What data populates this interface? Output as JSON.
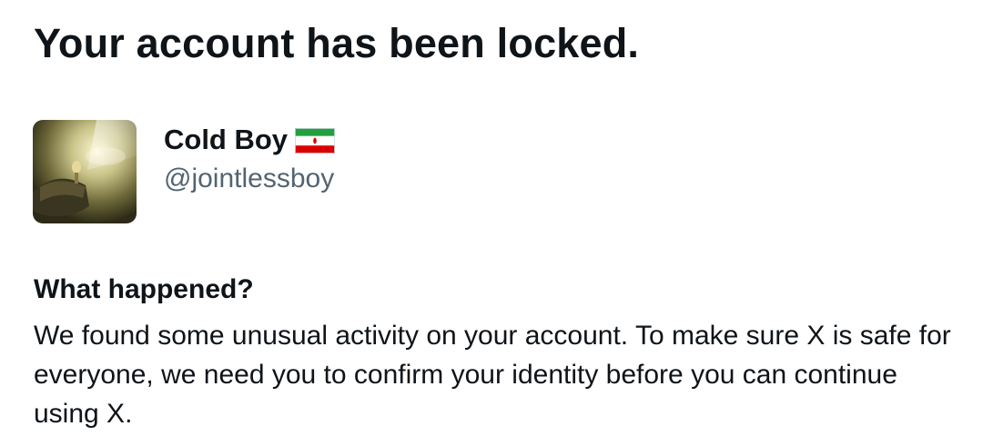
{
  "header": {
    "title": "Your account has been locked."
  },
  "account": {
    "display_name": "Cold Boy",
    "flag_emoji": "Iran flag",
    "handle": "@jointlessboy",
    "avatar_icon": "profile-picture"
  },
  "info": {
    "heading": "What happened?",
    "body": "We found some unusual activity on your account. To make sure X is safe for everyone, we need you to confirm your identity before you can continue using X."
  },
  "colors": {
    "text_primary": "#0f1419",
    "text_secondary": "#536471",
    "background": "#ffffff",
    "flag_green": "#239f40",
    "flag_red": "#da0000"
  }
}
